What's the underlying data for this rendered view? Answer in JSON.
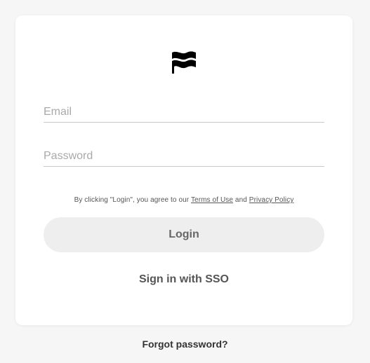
{
  "brand": {
    "logo_icon": "wavy-flag-logo"
  },
  "form": {
    "email_placeholder": "Email",
    "email_value": "",
    "password_placeholder": "Password",
    "password_value": ""
  },
  "terms": {
    "prefix": "By clicking \"Login\", you agree to our ",
    "terms_link": "Terms of Use",
    "middle": " and ",
    "privacy_link": "Privacy Policy"
  },
  "actions": {
    "login_label": "Login",
    "sso_label": "Sign in with SSO",
    "forgot_label": "Forgot password?"
  },
  "colors": {
    "background": "#f6f6f6",
    "card": "#ffffff",
    "button_bg": "#eeeeee",
    "button_text": "#666666"
  }
}
